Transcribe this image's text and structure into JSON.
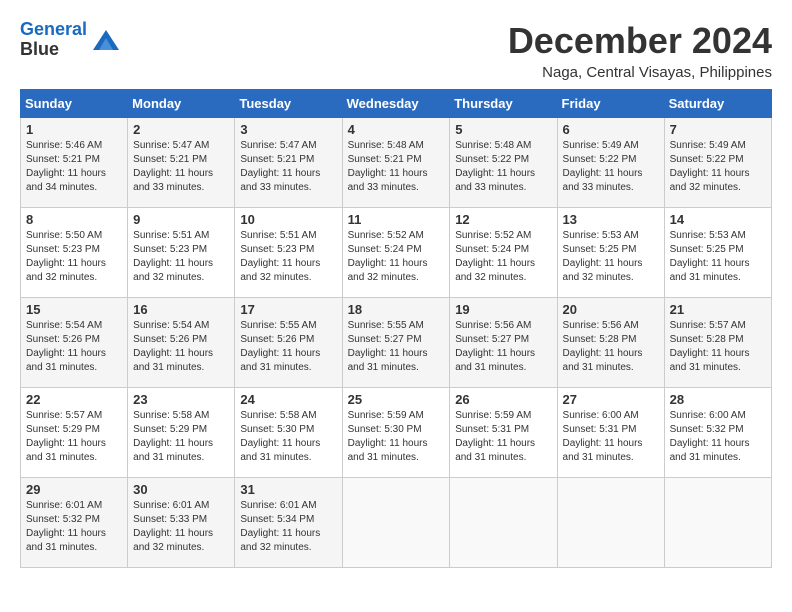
{
  "header": {
    "logo_line1": "General",
    "logo_line2": "Blue",
    "month_title": "December 2024",
    "location": "Naga, Central Visayas, Philippines"
  },
  "weekdays": [
    "Sunday",
    "Monday",
    "Tuesday",
    "Wednesday",
    "Thursday",
    "Friday",
    "Saturday"
  ],
  "weeks": [
    [
      {
        "day": "1",
        "sunrise": "5:46 AM",
        "sunset": "5:21 PM",
        "daylight": "11 hours and 34 minutes."
      },
      {
        "day": "2",
        "sunrise": "5:47 AM",
        "sunset": "5:21 PM",
        "daylight": "11 hours and 33 minutes."
      },
      {
        "day": "3",
        "sunrise": "5:47 AM",
        "sunset": "5:21 PM",
        "daylight": "11 hours and 33 minutes."
      },
      {
        "day": "4",
        "sunrise": "5:48 AM",
        "sunset": "5:21 PM",
        "daylight": "11 hours and 33 minutes."
      },
      {
        "day": "5",
        "sunrise": "5:48 AM",
        "sunset": "5:22 PM",
        "daylight": "11 hours and 33 minutes."
      },
      {
        "day": "6",
        "sunrise": "5:49 AM",
        "sunset": "5:22 PM",
        "daylight": "11 hours and 33 minutes."
      },
      {
        "day": "7",
        "sunrise": "5:49 AM",
        "sunset": "5:22 PM",
        "daylight": "11 hours and 32 minutes."
      }
    ],
    [
      {
        "day": "8",
        "sunrise": "5:50 AM",
        "sunset": "5:23 PM",
        "daylight": "11 hours and 32 minutes."
      },
      {
        "day": "9",
        "sunrise": "5:51 AM",
        "sunset": "5:23 PM",
        "daylight": "11 hours and 32 minutes."
      },
      {
        "day": "10",
        "sunrise": "5:51 AM",
        "sunset": "5:23 PM",
        "daylight": "11 hours and 32 minutes."
      },
      {
        "day": "11",
        "sunrise": "5:52 AM",
        "sunset": "5:24 PM",
        "daylight": "11 hours and 32 minutes."
      },
      {
        "day": "12",
        "sunrise": "5:52 AM",
        "sunset": "5:24 PM",
        "daylight": "11 hours and 32 minutes."
      },
      {
        "day": "13",
        "sunrise": "5:53 AM",
        "sunset": "5:25 PM",
        "daylight": "11 hours and 32 minutes."
      },
      {
        "day": "14",
        "sunrise": "5:53 AM",
        "sunset": "5:25 PM",
        "daylight": "11 hours and 31 minutes."
      }
    ],
    [
      {
        "day": "15",
        "sunrise": "5:54 AM",
        "sunset": "5:26 PM",
        "daylight": "11 hours and 31 minutes."
      },
      {
        "day": "16",
        "sunrise": "5:54 AM",
        "sunset": "5:26 PM",
        "daylight": "11 hours and 31 minutes."
      },
      {
        "day": "17",
        "sunrise": "5:55 AM",
        "sunset": "5:26 PM",
        "daylight": "11 hours and 31 minutes."
      },
      {
        "day": "18",
        "sunrise": "5:55 AM",
        "sunset": "5:27 PM",
        "daylight": "11 hours and 31 minutes."
      },
      {
        "day": "19",
        "sunrise": "5:56 AM",
        "sunset": "5:27 PM",
        "daylight": "11 hours and 31 minutes."
      },
      {
        "day": "20",
        "sunrise": "5:56 AM",
        "sunset": "5:28 PM",
        "daylight": "11 hours and 31 minutes."
      },
      {
        "day": "21",
        "sunrise": "5:57 AM",
        "sunset": "5:28 PM",
        "daylight": "11 hours and 31 minutes."
      }
    ],
    [
      {
        "day": "22",
        "sunrise": "5:57 AM",
        "sunset": "5:29 PM",
        "daylight": "11 hours and 31 minutes."
      },
      {
        "day": "23",
        "sunrise": "5:58 AM",
        "sunset": "5:29 PM",
        "daylight": "11 hours and 31 minutes."
      },
      {
        "day": "24",
        "sunrise": "5:58 AM",
        "sunset": "5:30 PM",
        "daylight": "11 hours and 31 minutes."
      },
      {
        "day": "25",
        "sunrise": "5:59 AM",
        "sunset": "5:30 PM",
        "daylight": "11 hours and 31 minutes."
      },
      {
        "day": "26",
        "sunrise": "5:59 AM",
        "sunset": "5:31 PM",
        "daylight": "11 hours and 31 minutes."
      },
      {
        "day": "27",
        "sunrise": "6:00 AM",
        "sunset": "5:31 PM",
        "daylight": "11 hours and 31 minutes."
      },
      {
        "day": "28",
        "sunrise": "6:00 AM",
        "sunset": "5:32 PM",
        "daylight": "11 hours and 31 minutes."
      }
    ],
    [
      {
        "day": "29",
        "sunrise": "6:01 AM",
        "sunset": "5:32 PM",
        "daylight": "11 hours and 31 minutes."
      },
      {
        "day": "30",
        "sunrise": "6:01 AM",
        "sunset": "5:33 PM",
        "daylight": "11 hours and 32 minutes."
      },
      {
        "day": "31",
        "sunrise": "6:01 AM",
        "sunset": "5:34 PM",
        "daylight": "11 hours and 32 minutes."
      },
      null,
      null,
      null,
      null
    ]
  ]
}
